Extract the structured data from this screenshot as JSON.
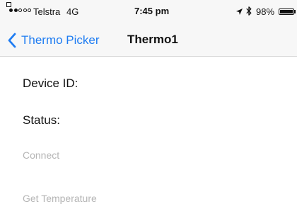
{
  "status_bar": {
    "carrier": "Telstra",
    "network": "4G",
    "time": "7:45 pm",
    "battery_percent": "98%",
    "battery_level": 0.98,
    "signal_bars_filled": 2,
    "signal_bars_total": 5,
    "icons": [
      "location-arrow-icon",
      "bluetooth-icon",
      "battery-icon"
    ]
  },
  "nav": {
    "back_label": "Thermo Picker",
    "title": "Thermo1"
  },
  "fields": {
    "device_id_label": "Device ID:",
    "status_label": "Status:"
  },
  "actions": {
    "connect_label": "Connect",
    "get_temperature_label": "Get Temperature"
  },
  "colors": {
    "accent": "#1e7cf2",
    "disabled_text": "#b5b5b5",
    "bar_background": "#f7f7f7"
  }
}
